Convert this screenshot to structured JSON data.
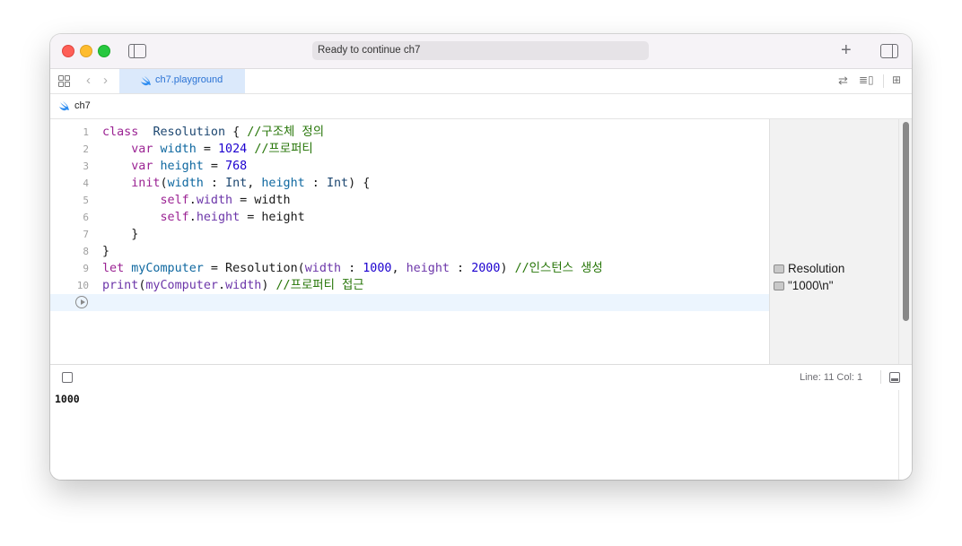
{
  "window": {
    "status": "Ready to continue ch7"
  },
  "tab": {
    "label": "ch7.playground"
  },
  "breadcrumb": {
    "label": "ch7"
  },
  "editor": {
    "line_numbers": [
      "1",
      "2",
      "3",
      "4",
      "5",
      "6",
      "7",
      "8",
      "9",
      "10"
    ],
    "lines": [
      [
        [
          "kw",
          "class"
        ],
        [
          "",
          "  "
        ],
        [
          "ty",
          "Resolution"
        ],
        [
          "",
          " { "
        ],
        [
          "cm",
          "//구조체 정의"
        ]
      ],
      [
        [
          "",
          "    "
        ],
        [
          "kw",
          "var"
        ],
        [
          "",
          " "
        ],
        [
          "pr",
          "width"
        ],
        [
          "",
          " = "
        ],
        [
          "nm",
          "1024"
        ],
        [
          "",
          " "
        ],
        [
          "cm",
          "//프로퍼티"
        ]
      ],
      [
        [
          "",
          "    "
        ],
        [
          "kw",
          "var"
        ],
        [
          "",
          " "
        ],
        [
          "pr",
          "height"
        ],
        [
          "",
          " = "
        ],
        [
          "nm",
          "768"
        ]
      ],
      [
        [
          "",
          "    "
        ],
        [
          "kw",
          "init"
        ],
        [
          "",
          "("
        ],
        [
          "pr",
          "width"
        ],
        [
          "",
          " : "
        ],
        [
          "ty",
          "Int"
        ],
        [
          "",
          ", "
        ],
        [
          "pr",
          "height"
        ],
        [
          "",
          " : "
        ],
        [
          "ty",
          "Int"
        ],
        [
          "",
          ") {"
        ]
      ],
      [
        [
          "",
          "        "
        ],
        [
          "kw",
          "self"
        ],
        [
          "",
          "."
        ],
        [
          "me",
          "width"
        ],
        [
          "",
          " = width"
        ]
      ],
      [
        [
          "",
          "        "
        ],
        [
          "kw",
          "self"
        ],
        [
          "",
          "."
        ],
        [
          "me",
          "height"
        ],
        [
          "",
          " = height"
        ]
      ],
      [
        [
          "",
          "    }"
        ]
      ],
      [
        [
          "",
          "}"
        ]
      ],
      [
        [
          "kw",
          "let"
        ],
        [
          "",
          " "
        ],
        [
          "pr",
          "myComputer"
        ],
        [
          "",
          " = Resolution("
        ],
        [
          "me",
          "width"
        ],
        [
          "",
          " : "
        ],
        [
          "nm",
          "1000"
        ],
        [
          "",
          ", "
        ],
        [
          "me",
          "height"
        ],
        [
          "",
          " : "
        ],
        [
          "nm",
          "2000"
        ],
        [
          "",
          ") "
        ],
        [
          "cm",
          "//인스턴스 생성"
        ]
      ],
      [
        [
          "me",
          "print"
        ],
        [
          "",
          "("
        ],
        [
          "me",
          "myComputer"
        ],
        [
          "",
          "."
        ],
        [
          "me",
          "width"
        ],
        [
          "",
          ") "
        ],
        [
          "cm",
          "//프로퍼티 접근"
        ]
      ]
    ]
  },
  "results": [
    {
      "line": 9,
      "text": "Resolution"
    },
    {
      "line": 10,
      "text": "\"1000\\n\""
    }
  ],
  "status_bar": {
    "line_col": "Line: 11  Col: 1"
  },
  "console": {
    "output": "1000"
  },
  "colors": {
    "keyword": "#9b2393",
    "type": "#1c4670",
    "number": "#1c00cf",
    "property": "#0f68a0",
    "comment": "#267507",
    "member": "#6c36a9",
    "tab_active_bg": "#dbe9fb",
    "tab_active_text": "#2a72d4"
  }
}
